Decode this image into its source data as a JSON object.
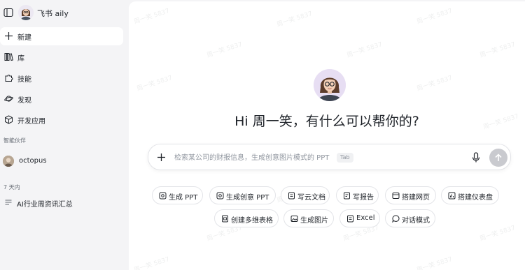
{
  "sidebar": {
    "brand_name": "飞书 aily",
    "nav": [
      {
        "label": "新建",
        "icon": "plus-icon"
      },
      {
        "label": "库",
        "icon": "library-icon"
      },
      {
        "label": "技能",
        "icon": "puzzle-icon"
      },
      {
        "label": "发现",
        "icon": "planet-icon"
      },
      {
        "label": "开发应用",
        "icon": "cube-icon"
      }
    ],
    "partners_label": "智能伙伴",
    "partner": {
      "name": "octopus"
    },
    "recent_label": "7 天内",
    "history": [
      {
        "label": "AI行业周资讯汇总",
        "icon": "document-icon"
      }
    ]
  },
  "main": {
    "greeting": "Hi 周一笑，有什么可以帮你的?",
    "input": {
      "placeholder": "检索某公司的财报信息，生成创意图片模式的 PPT",
      "value": "",
      "tab_hint": "Tab"
    },
    "chips_row1": [
      {
        "label": "生成 PPT",
        "icon": "ppt-icon"
      },
      {
        "label": "生成创意 PPT",
        "icon": "creative-ppt-icon"
      },
      {
        "label": "写云文档",
        "icon": "doc-icon"
      },
      {
        "label": "写报告",
        "icon": "report-icon"
      },
      {
        "label": "搭建网页",
        "icon": "webpage-icon"
      },
      {
        "label": "搭建仪表盘",
        "icon": "dashboard-icon"
      }
    ],
    "chips_row2": [
      {
        "label": "创建多维表格",
        "icon": "base-icon"
      },
      {
        "label": "生成图片",
        "icon": "image-icon"
      },
      {
        "label": "Excel",
        "icon": "excel-icon"
      },
      {
        "label": "对话模式",
        "icon": "chat-icon"
      }
    ],
    "watermark": "周一笑 5837"
  },
  "colors": {
    "sidebar_bg": "#f4f4f6",
    "main_bg": "#ffffff",
    "send_disabled": "#c9cacf"
  }
}
